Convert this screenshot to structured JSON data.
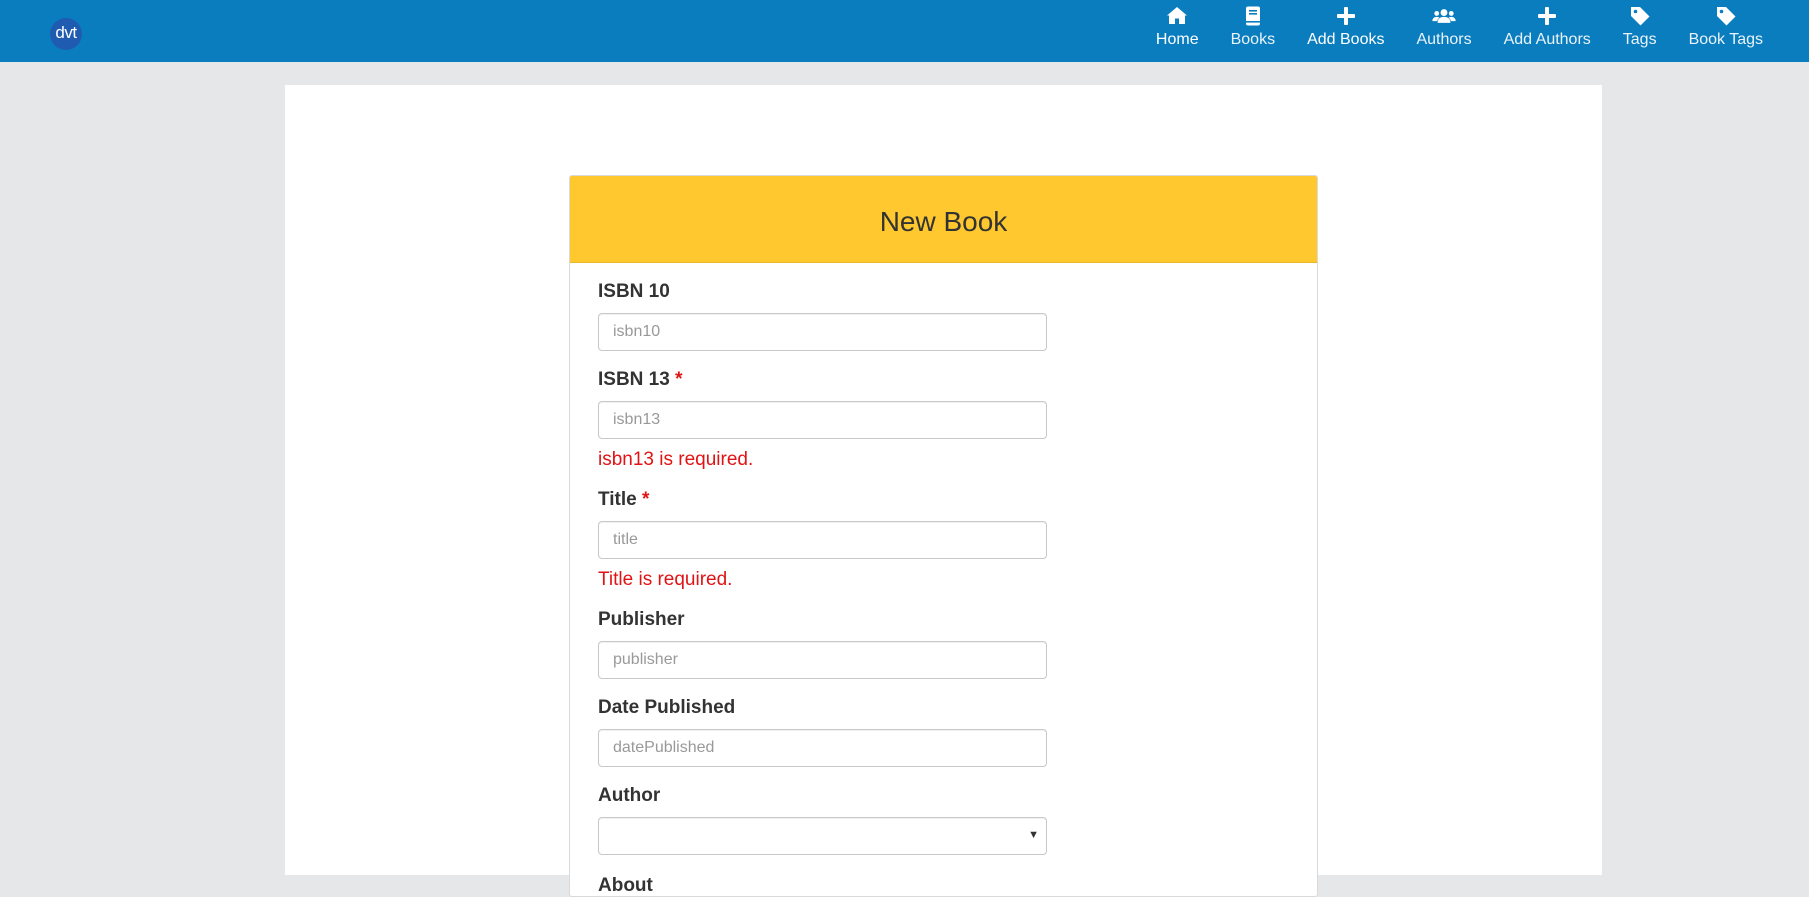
{
  "brand": {
    "logo_text": "dvt"
  },
  "nav": [
    {
      "label": "Home",
      "icon": "home-icon"
    },
    {
      "label": "Books",
      "icon": "book-icon"
    },
    {
      "label": "Add Books",
      "icon": "plus-icon"
    },
    {
      "label": "Authors",
      "icon": "users-icon"
    },
    {
      "label": "Add Authors",
      "icon": "plus-icon"
    },
    {
      "label": "Tags",
      "icon": "tag-icon"
    },
    {
      "label": "Book Tags",
      "icon": "tag-icon"
    }
  ],
  "colors": {
    "topbar": "#0a7dbf",
    "card_header": "#ffc82e",
    "error": "#e01414",
    "background": "#e6e7e9"
  },
  "form": {
    "title": "New Book",
    "required_marker": "*",
    "fields": {
      "isbn10": {
        "label": "ISBN 10",
        "placeholder": "isbn10",
        "value": ""
      },
      "isbn13": {
        "label": "ISBN 13",
        "placeholder": "isbn13",
        "value": "",
        "error": "isbn13 is required."
      },
      "title": {
        "label": "Title",
        "placeholder": "title",
        "value": "",
        "error": "Title is required."
      },
      "publisher": {
        "label": "Publisher",
        "placeholder": "publisher",
        "value": ""
      },
      "date_published": {
        "label": "Date Published",
        "placeholder": "datePublished",
        "value": ""
      },
      "author": {
        "label": "Author",
        "selected": ""
      },
      "about": {
        "label": "About"
      }
    }
  }
}
